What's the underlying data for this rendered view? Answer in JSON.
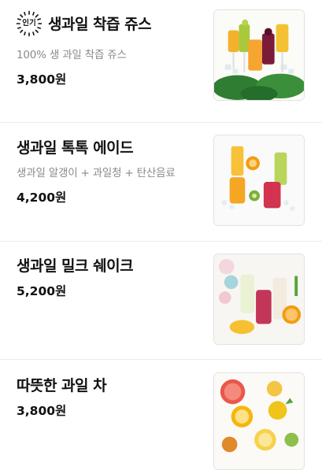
{
  "items": [
    {
      "badge": "인기",
      "title": "생과일 착즙 쥬스",
      "description": "100% 생 과일 착즙 쥬스",
      "price": "3,800원",
      "image_icon": "fresh-juice-photo"
    },
    {
      "title": "생과일 톡톡 에이드",
      "description": "생과일 알갱이 + 과일청 + 탄산음료",
      "price": "4,200원",
      "image_icon": "fruit-ade-photo"
    },
    {
      "title": "생과일 밀크 쉐이크",
      "price": "5,200원",
      "image_icon": "milkshake-photo"
    },
    {
      "title": "따뜻한 과일 차",
      "price": "3,800원",
      "image_icon": "fruit-tea-photo"
    }
  ]
}
